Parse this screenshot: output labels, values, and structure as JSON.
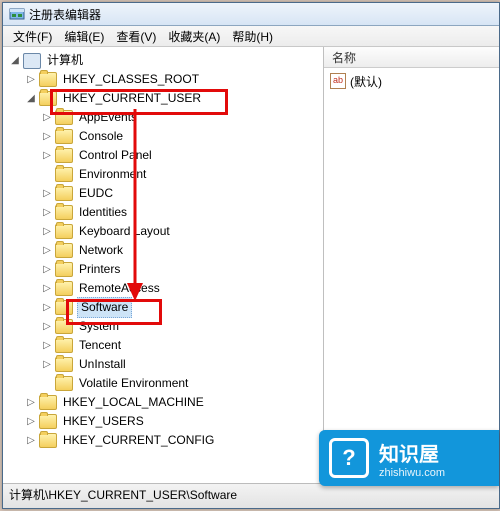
{
  "title": "注册表编辑器",
  "menus": [
    "文件(F)",
    "编辑(E)",
    "查看(V)",
    "收藏夹(A)",
    "帮助(H)"
  ],
  "right_panel": {
    "col_header": "名称",
    "default_value": "(默认)"
  },
  "status_path": "计算机\\HKEY_CURRENT_USER\\Software",
  "tree": {
    "root": "计算机",
    "hives": [
      {
        "name": "HKEY_CLASSES_ROOT",
        "expanded": false
      },
      {
        "name": "HKEY_CURRENT_USER",
        "expanded": true,
        "highlighted": true,
        "children": [
          {
            "name": "AppEvents"
          },
          {
            "name": "Console"
          },
          {
            "name": "Control Panel"
          },
          {
            "name": "Environment"
          },
          {
            "name": "EUDC"
          },
          {
            "name": "Identities"
          },
          {
            "name": "Keyboard Layout"
          },
          {
            "name": "Network"
          },
          {
            "name": "Printers"
          },
          {
            "name": "RemoteAccess"
          },
          {
            "name": "Software",
            "selected": true,
            "highlighted": true
          },
          {
            "name": "System"
          },
          {
            "name": "Tencent"
          },
          {
            "name": "UnInstall"
          },
          {
            "name": "Volatile Environment"
          }
        ]
      },
      {
        "name": "HKEY_LOCAL_MACHINE",
        "expanded": false
      },
      {
        "name": "HKEY_USERS",
        "expanded": false
      },
      {
        "name": "HKEY_CURRENT_CONFIG",
        "expanded": false
      }
    ]
  },
  "watermark": {
    "brand": "知识屋",
    "url": "zhishiwu.com",
    "glyph": "?"
  }
}
